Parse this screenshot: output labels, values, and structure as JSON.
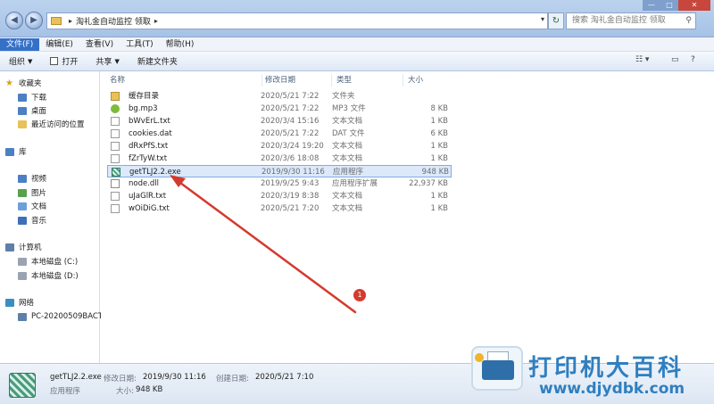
{
  "address": {
    "crumb1": "淘礼金自动监控 领取",
    "arrow": "▸",
    "search_placeholder": "搜索 淘礼金自动监控 领取"
  },
  "window": {
    "min": "—",
    "max": "□",
    "close": "✕"
  },
  "menu": {
    "items": [
      "文件(F)",
      "编辑(E)",
      "查看(V)",
      "工具(T)",
      "帮助(H)"
    ]
  },
  "toolbar": {
    "organize": "组织",
    "open": "打开",
    "share": "共享",
    "new_folder": "新建文件夹"
  },
  "nav": {
    "favorites": "收藏夹",
    "downloads": "下载",
    "desktop": "桌面",
    "recent": "最近访问的位置",
    "libraries": "库",
    "videos": "视频",
    "pictures": "图片",
    "documents": "文档",
    "music": "音乐",
    "computer": "计算机",
    "drive_c": "本地磁盘 (C:)",
    "drive_d": "本地磁盘 (D:)",
    "network": "网络",
    "pc": "PC-20200509BACT"
  },
  "columns": {
    "name": "名称",
    "date": "修改日期",
    "type": "类型",
    "size": "大小"
  },
  "files": [
    {
      "name": "缓存目录",
      "date": "2020/5/21 7:22",
      "type": "文件夹",
      "size": "",
      "icon": "folder-icon"
    },
    {
      "name": "bg.mp3",
      "date": "2020/5/21 7:22",
      "type": "MP3 文件",
      "size": "8 KB",
      "icon": "mp3-icon"
    },
    {
      "name": "bWvErL.txt",
      "date": "2020/3/4 15:16",
      "type": "文本文档",
      "size": "1 KB",
      "icon": "txt-icon"
    },
    {
      "name": "cookies.dat",
      "date": "2020/5/21 7:22",
      "type": "DAT 文件",
      "size": "6 KB",
      "icon": "dat-icon"
    },
    {
      "name": "dRxPfS.txt",
      "date": "2020/3/24 19:20",
      "type": "文本文档",
      "size": "1 KB",
      "icon": "txt-icon"
    },
    {
      "name": "fZrTyW.txt",
      "date": "2020/3/6 18:08",
      "type": "文本文档",
      "size": "1 KB",
      "icon": "txt-icon"
    },
    {
      "name": "getTLJ2.2.exe",
      "date": "2019/9/30 11:16",
      "type": "应用程序",
      "size": "948 KB",
      "icon": "exe-icon"
    },
    {
      "name": "node.dll",
      "date": "2019/9/25 9:43",
      "type": "应用程序扩展",
      "size": "22,937 KB",
      "icon": "dll-icon"
    },
    {
      "name": "uJaGlR.txt",
      "date": "2020/3/19 8:38",
      "type": "文本文档",
      "size": "1 KB",
      "icon": "txt-icon"
    },
    {
      "name": "wOiDiG.txt",
      "date": "2020/5/21 7:20",
      "type": "文本文档",
      "size": "1 KB",
      "icon": "txt-icon"
    }
  ],
  "selected_index": 6,
  "annotation": {
    "badge": "1",
    "color": "#d43a2e"
  },
  "details": {
    "filename": "getTLJ2.2.exe",
    "modified_label": "修改日期:",
    "modified_value": "2019/9/30 11:16",
    "created_label": "创建日期:",
    "created_value": "2020/5/21 7:10",
    "type": "应用程序",
    "size_label": "大小:",
    "size_value": "948 KB"
  },
  "watermark": {
    "title": "打印机大百科",
    "url": "www.djydbk.com"
  }
}
